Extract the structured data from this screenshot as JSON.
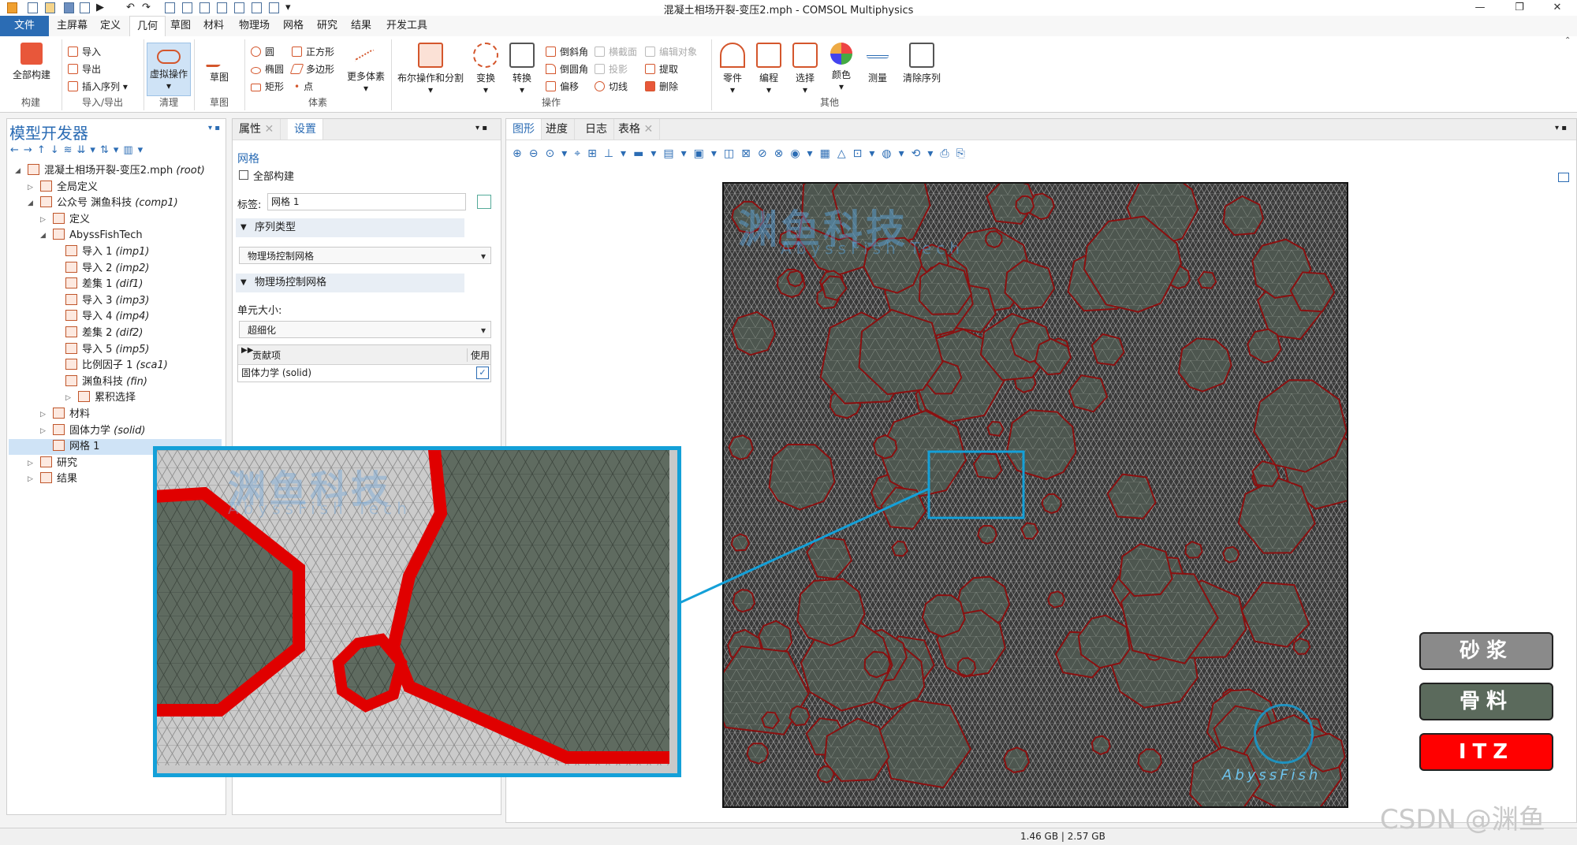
{
  "window": {
    "title": "混凝土相场开裂-变压2.mph - COMSOL Multiphysics",
    "minimize": "—",
    "maximize": "❐",
    "close": "✕"
  },
  "menu": {
    "tabs": [
      "文件",
      "主屏幕",
      "定义",
      "几何",
      "草图",
      "材料",
      "物理场",
      "网格",
      "研究",
      "结果",
      "开发工具"
    ],
    "active": "几何"
  },
  "ribbon": {
    "groups": {
      "build": {
        "label": "构建",
        "full_build": "全部构建"
      },
      "import_export": {
        "label": "导入/导出",
        "import": "导入",
        "export": "导出",
        "insert_sequence": "插入序列"
      },
      "cleanup": {
        "label": "清理",
        "virtual_ops": "虚拟操作"
      },
      "sketch": {
        "label": "草图",
        "sketch": "草图"
      },
      "primitives": {
        "label": "体素",
        "circle": "圆",
        "ellipse": "椭圆",
        "rectangle": "矩形",
        "square": "正方形",
        "polygon": "多边形",
        "point": "点",
        "more": "更多体素"
      },
      "operations": {
        "label": "操作",
        "boolean": "布尔操作和分割",
        "transform": "变换",
        "convert": "转换",
        "chamfer": "倒斜角",
        "fillet": "倒圆角",
        "offset": "偏移",
        "cross_section": "横截面",
        "projection": "投影",
        "tangent": "切线",
        "edit_object": "编辑对象",
        "extract": "提取",
        "delete": "删除"
      },
      "other": {
        "label": "其他",
        "parts": "零件",
        "programming": "编程",
        "select": "选择",
        "color": "颜色",
        "measure": "测量",
        "clear_sequence": "清除序列"
      }
    }
  },
  "model_builder": {
    "title": "模型开发器",
    "tree": [
      {
        "label": "混凝土相场开裂-变压2.mph",
        "tag": "(root)"
      },
      {
        "label": "全局定义",
        "tag": ""
      },
      {
        "label": "公众号 渊鱼科技",
        "tag": "(comp1)"
      },
      {
        "label": "定义",
        "tag": ""
      },
      {
        "label": "AbyssFishTech",
        "tag": ""
      },
      {
        "label": "导入 1",
        "tag": "(imp1)"
      },
      {
        "label": "导入 2",
        "tag": "(imp2)"
      },
      {
        "label": "差集 1",
        "tag": "(dif1)"
      },
      {
        "label": "导入 3",
        "tag": "(imp3)"
      },
      {
        "label": "导入 4",
        "tag": "(imp4)"
      },
      {
        "label": "差集 2",
        "tag": "(dif2)"
      },
      {
        "label": "导入 5",
        "tag": "(imp5)"
      },
      {
        "label": "比例因子 1",
        "tag": "(sca1)"
      },
      {
        "label": "渊鱼科技",
        "tag": "(fin)"
      },
      {
        "label": "累积选择",
        "tag": ""
      },
      {
        "label": "材料",
        "tag": ""
      },
      {
        "label": "固体力学",
        "tag": "(solid)"
      },
      {
        "label": "网格 1",
        "tag": ""
      },
      {
        "label": "研究",
        "tag": ""
      },
      {
        "label": "结果",
        "tag": ""
      }
    ]
  },
  "settings": {
    "tabs": [
      "属性",
      "设置"
    ],
    "node_type": "网格",
    "build_all": "全部构建",
    "label_caption": "标签:",
    "label_value": "网格 1",
    "section_sequence": "序列类型",
    "sequence_value": "物理场控制网格",
    "section_physics": "物理场控制网格",
    "element_size_caption": "单元大小:",
    "element_size_value": "超细化",
    "table_header_contrib": "贡献项",
    "table_header_use": "使用",
    "table_row_contrib": "固体力学 (solid)"
  },
  "graphics": {
    "tabs": [
      "图形",
      "进度",
      "日志",
      "表格"
    ]
  },
  "watermark": {
    "cn": "渊鱼科技",
    "en": "AbyssFish Tech",
    "logo_text": "AbyssFish"
  },
  "legend": [
    {
      "label": "砂浆",
      "color": "#8a8a8a",
      "text_color": "#ffffff"
    },
    {
      "label": "骨料",
      "color": "#5b6a5c",
      "text_color": "#ffffff"
    },
    {
      "label": "ITZ",
      "color": "#ff0000",
      "text_color": "#ffffff"
    }
  ],
  "colors": {
    "accent": "#2b6cb4",
    "mortar": "#c9c9c9",
    "aggregate": "#5f6b60",
    "itz": "#e00000",
    "zoom_border": "#14a0d8"
  },
  "status": {
    "memory": "1.46 GB | 2.57 GB"
  },
  "corner_watermark": "CSDN @渊鱼"
}
